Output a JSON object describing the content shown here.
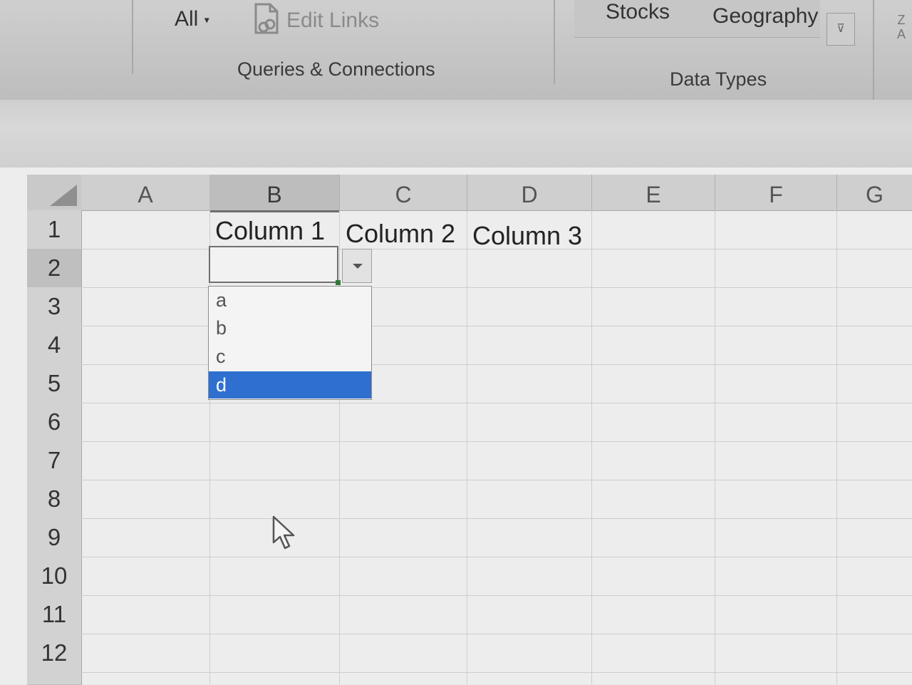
{
  "ribbon": {
    "refresh_all_label": "All",
    "edit_links_label": "Edit Links",
    "queries_group_label": "Queries & Connections",
    "stocks_label": "Stocks",
    "geography_label": "Geography",
    "data_types_group_label": "Data Types",
    "sort_icon_text": "Z\nA"
  },
  "sheet": {
    "columns": [
      "A",
      "B",
      "C",
      "D",
      "E",
      "F",
      "G"
    ],
    "rows": [
      "1",
      "2",
      "3",
      "4",
      "5",
      "6",
      "7",
      "8",
      "9",
      "10",
      "11",
      "12"
    ],
    "selected_column": "B",
    "selected_row": "2",
    "cells": {
      "B1": "Column 1",
      "C1": "Column 2",
      "D1": "Column 3"
    }
  },
  "dropdown": {
    "items": [
      "a",
      "b",
      "c",
      "d"
    ],
    "selected": "d"
  }
}
